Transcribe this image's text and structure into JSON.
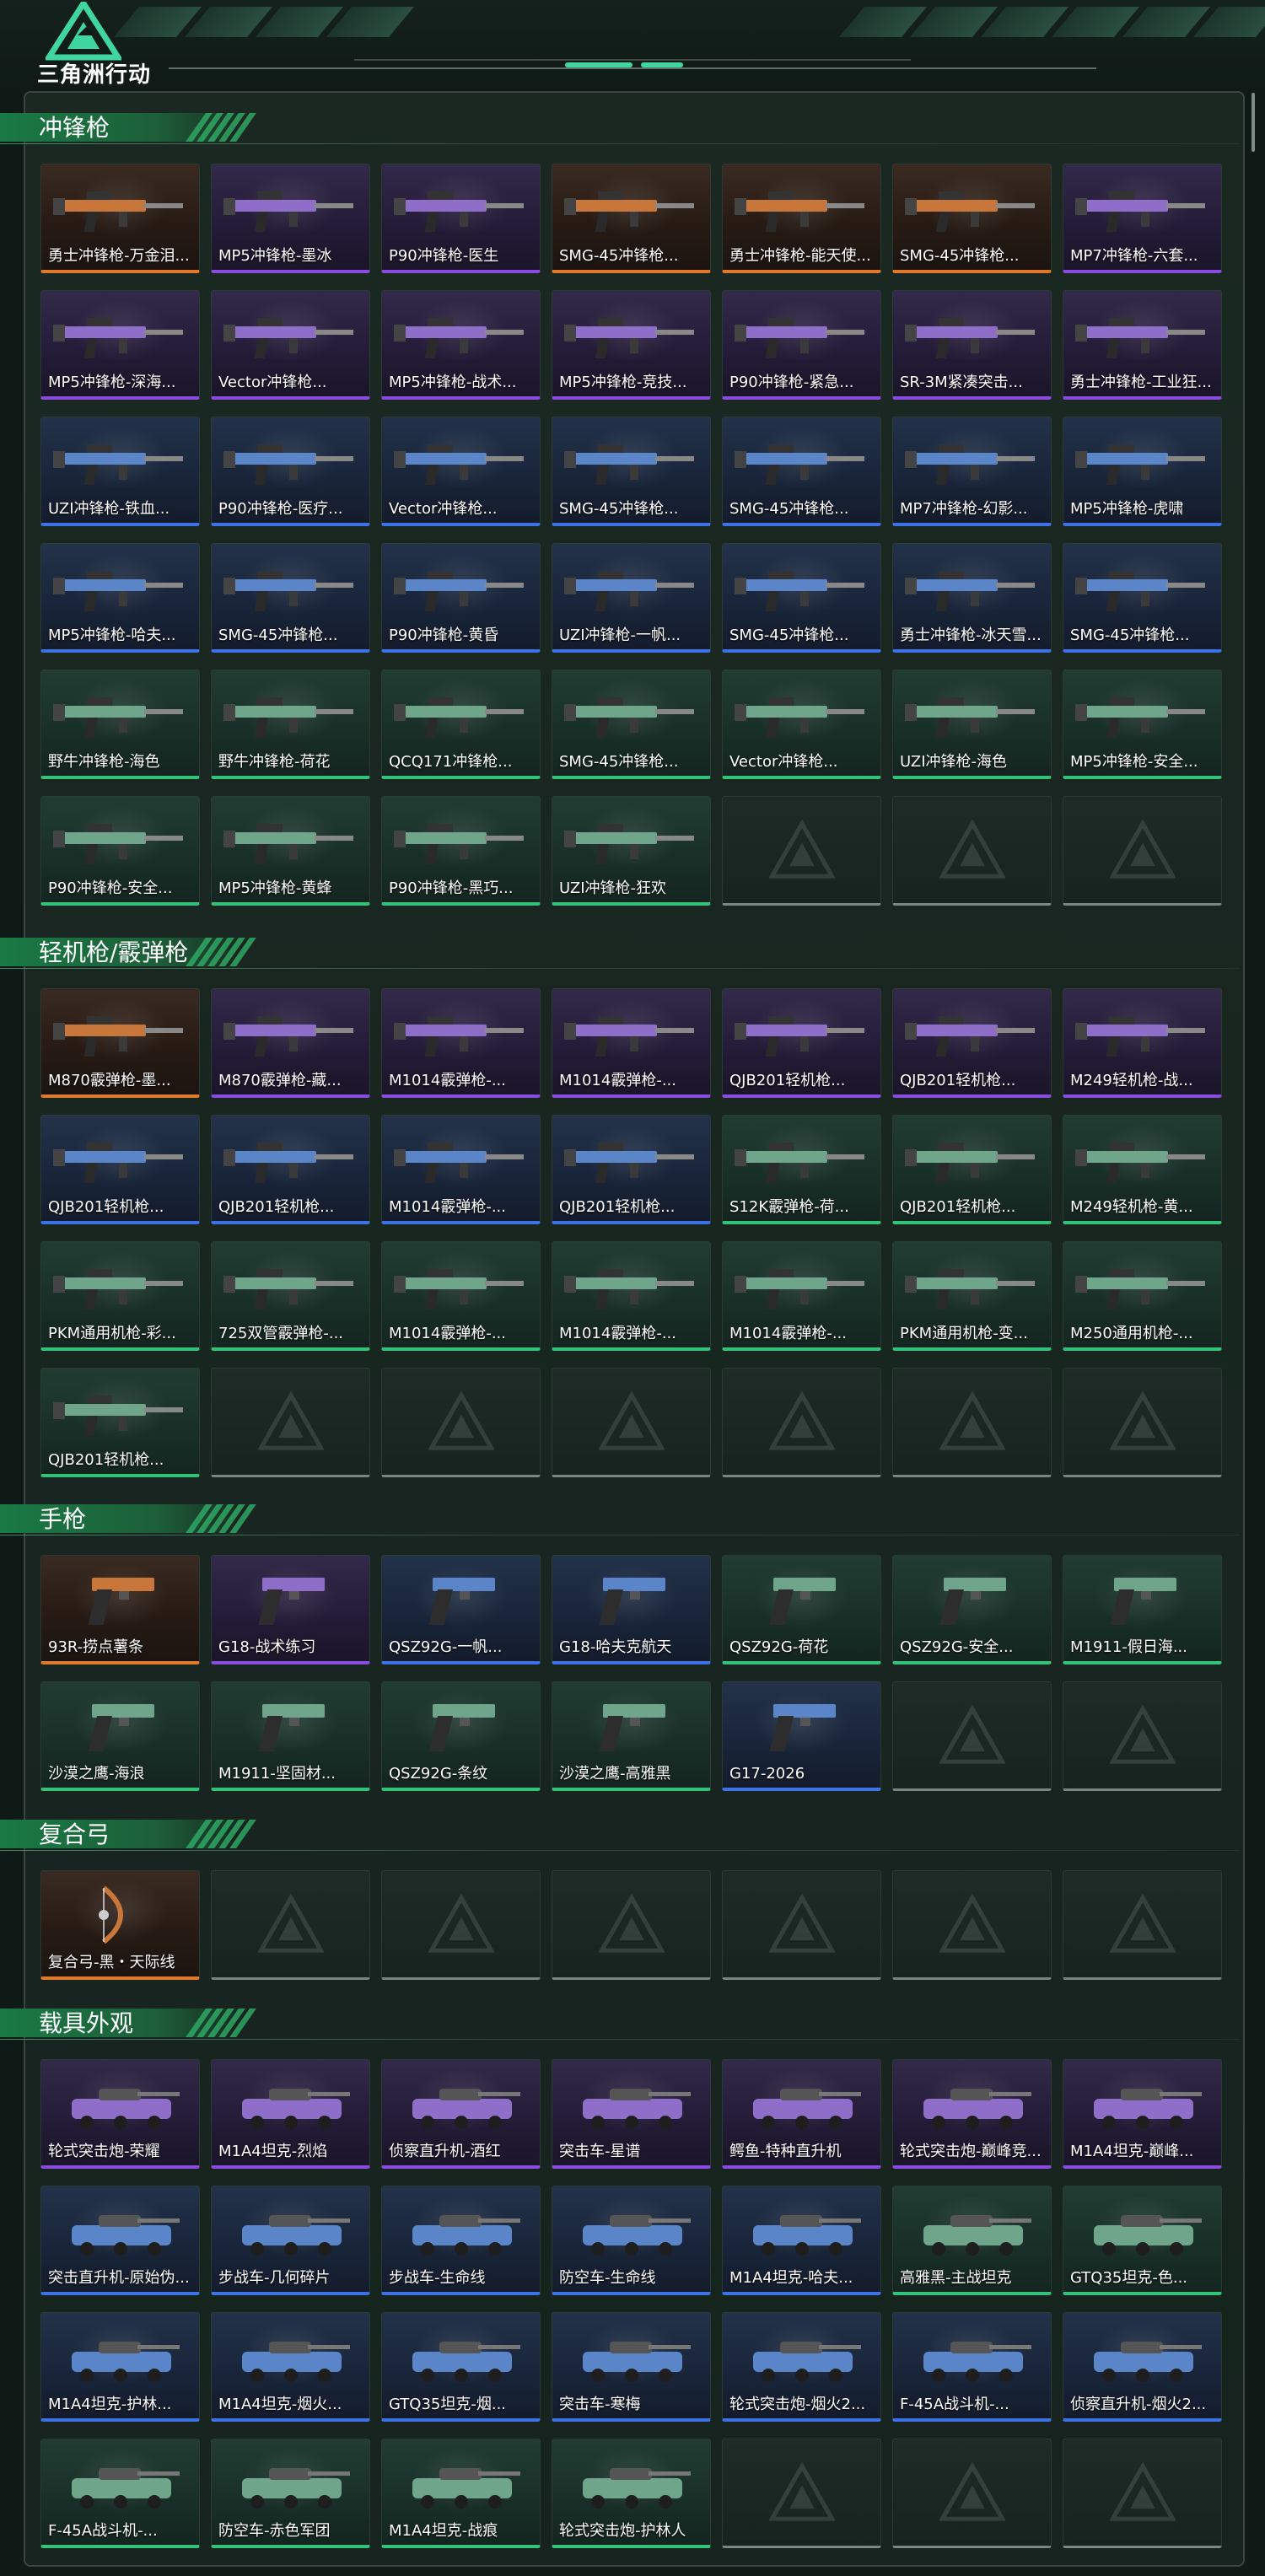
{
  "header": {
    "logo_text": "三角洲行动",
    "logo_icon": "delta-logo-icon"
  },
  "colors": {
    "orange": "#e07a2a",
    "purple": "#8a4ce0",
    "blue": "#3c72e6",
    "green": "#33c27a",
    "accent": "#3fd6a0"
  },
  "sections": [
    {
      "title": "冲锋枪",
      "kind": "gun",
      "items": [
        {
          "label": "勇士冲锋枪-万金泪...",
          "rarity": "orange"
        },
        {
          "label": "MP5冲锋枪-墨冰",
          "rarity": "purple"
        },
        {
          "label": "P90冲锋枪-医生",
          "rarity": "purple"
        },
        {
          "label": "SMG-45冲锋枪...",
          "rarity": "orange"
        },
        {
          "label": "勇士冲锋枪-能天使...",
          "rarity": "orange"
        },
        {
          "label": "SMG-45冲锋枪...",
          "rarity": "orange"
        },
        {
          "label": "MP7冲锋枪-六套...",
          "rarity": "purple"
        },
        {
          "label": "MP5冲锋枪-深海...",
          "rarity": "purple"
        },
        {
          "label": "Vector冲锋枪...",
          "rarity": "purple"
        },
        {
          "label": "MP5冲锋枪-战术...",
          "rarity": "purple"
        },
        {
          "label": "MP5冲锋枪-竞技...",
          "rarity": "purple"
        },
        {
          "label": "P90冲锋枪-紧急...",
          "rarity": "purple"
        },
        {
          "label": "SR-3M紧凑突击...",
          "rarity": "purple"
        },
        {
          "label": "勇士冲锋枪-工业狂...",
          "rarity": "purple"
        },
        {
          "label": "UZI冲锋枪-铁血...",
          "rarity": "blue"
        },
        {
          "label": "P90冲锋枪-医疗...",
          "rarity": "blue"
        },
        {
          "label": "Vector冲锋枪...",
          "rarity": "blue"
        },
        {
          "label": "SMG-45冲锋枪...",
          "rarity": "blue"
        },
        {
          "label": "SMG-45冲锋枪...",
          "rarity": "blue"
        },
        {
          "label": "MP7冲锋枪-幻影...",
          "rarity": "blue"
        },
        {
          "label": "MP5冲锋枪-虎啸",
          "rarity": "blue"
        },
        {
          "label": "MP5冲锋枪-哈夫...",
          "rarity": "blue"
        },
        {
          "label": "SMG-45冲锋枪...",
          "rarity": "blue"
        },
        {
          "label": "P90冲锋枪-黄昏",
          "rarity": "blue"
        },
        {
          "label": "UZI冲锋枪-一帆...",
          "rarity": "blue"
        },
        {
          "label": "SMG-45冲锋枪...",
          "rarity": "blue"
        },
        {
          "label": "勇士冲锋枪-冰天雪...",
          "rarity": "blue"
        },
        {
          "label": "SMG-45冲锋枪...",
          "rarity": "blue"
        },
        {
          "label": "野牛冲锋枪-海色",
          "rarity": "green"
        },
        {
          "label": "野牛冲锋枪-荷花",
          "rarity": "green"
        },
        {
          "label": "QCQ171冲锋枪...",
          "rarity": "green"
        },
        {
          "label": "SMG-45冲锋枪...",
          "rarity": "green"
        },
        {
          "label": "Vector冲锋枪...",
          "rarity": "green"
        },
        {
          "label": "UZI冲锋枪-海色",
          "rarity": "green"
        },
        {
          "label": "MP5冲锋枪-安全...",
          "rarity": "green"
        },
        {
          "label": "P90冲锋枪-安全...",
          "rarity": "green"
        },
        {
          "label": "MP5冲锋枪-黄蜂",
          "rarity": "green"
        },
        {
          "label": "P90冲锋枪-黑巧...",
          "rarity": "green"
        },
        {
          "label": "UZI冲锋枪-狂欢",
          "rarity": "green"
        }
      ],
      "empty": 3
    },
    {
      "title": "轻机枪/霰弹枪",
      "kind": "gun",
      "items": [
        {
          "label": "M870霰弹枪-墨...",
          "rarity": "orange"
        },
        {
          "label": "M870霰弹枪-藏...",
          "rarity": "purple"
        },
        {
          "label": "M1014霰弹枪-...",
          "rarity": "purple"
        },
        {
          "label": "M1014霰弹枪-...",
          "rarity": "purple"
        },
        {
          "label": "QJB201轻机枪...",
          "rarity": "purple"
        },
        {
          "label": "QJB201轻机枪...",
          "rarity": "purple"
        },
        {
          "label": "M249轻机枪-战...",
          "rarity": "purple"
        },
        {
          "label": "QJB201轻机枪...",
          "rarity": "blue"
        },
        {
          "label": "QJB201轻机枪...",
          "rarity": "blue"
        },
        {
          "label": "M1014霰弹枪-...",
          "rarity": "blue"
        },
        {
          "label": "QJB201轻机枪...",
          "rarity": "blue"
        },
        {
          "label": "S12K霰弹枪-荷...",
          "rarity": "green"
        },
        {
          "label": "QJB201轻机枪...",
          "rarity": "green"
        },
        {
          "label": "M249轻机枪-黄...",
          "rarity": "green"
        },
        {
          "label": "PKM通用机枪-彩...",
          "rarity": "green"
        },
        {
          "label": "725双管霰弹枪-...",
          "rarity": "green"
        },
        {
          "label": "M1014霰弹枪-...",
          "rarity": "green"
        },
        {
          "label": "M1014霰弹枪-...",
          "rarity": "green"
        },
        {
          "label": "M1014霰弹枪-...",
          "rarity": "green"
        },
        {
          "label": "PKM通用机枪-变...",
          "rarity": "green"
        },
        {
          "label": "M250通用机枪-...",
          "rarity": "green"
        },
        {
          "label": "QJB201轻机枪...",
          "rarity": "green"
        }
      ],
      "empty": 6
    },
    {
      "title": "手枪",
      "kind": "pistol",
      "items": [
        {
          "label": "93R-捞点薯条",
          "rarity": "orange"
        },
        {
          "label": "G18-战术练习",
          "rarity": "purple"
        },
        {
          "label": "QSZ92G-一帆...",
          "rarity": "blue"
        },
        {
          "label": "G18-哈夫克航天",
          "rarity": "blue"
        },
        {
          "label": "QSZ92G-荷花",
          "rarity": "green"
        },
        {
          "label": "QSZ92G-安全...",
          "rarity": "green"
        },
        {
          "label": "M1911-假日海...",
          "rarity": "green"
        },
        {
          "label": "沙漠之鹰-海浪",
          "rarity": "green"
        },
        {
          "label": "M1911-坚固材...",
          "rarity": "green"
        },
        {
          "label": "QSZ92G-条纹",
          "rarity": "green"
        },
        {
          "label": "沙漠之鹰-高雅黑",
          "rarity": "green"
        },
        {
          "label": "G17-2026",
          "rarity": "blue"
        }
      ],
      "empty": 2
    },
    {
      "title": "复合弓",
      "kind": "bow",
      "items": [
        {
          "label": "复合弓-黑・天际线",
          "rarity": "orange"
        }
      ],
      "empty": 6
    },
    {
      "title": "载具外观",
      "kind": "vehicle",
      "items": [
        {
          "label": "轮式突击炮-荣耀",
          "rarity": "purple"
        },
        {
          "label": "M1A4坦克-烈焰",
          "rarity": "purple"
        },
        {
          "label": "侦察直升机-酒红",
          "rarity": "purple"
        },
        {
          "label": "突击车-星谱",
          "rarity": "purple"
        },
        {
          "label": "鳄鱼-特种直升机",
          "rarity": "purple"
        },
        {
          "label": "轮式突击炮-巅峰竞...",
          "rarity": "purple"
        },
        {
          "label": "M1A4坦克-巅峰...",
          "rarity": "purple"
        },
        {
          "label": "突击直升机-原始伪...",
          "rarity": "blue"
        },
        {
          "label": "步战车-几何碎片",
          "rarity": "blue"
        },
        {
          "label": "步战车-生命线",
          "rarity": "blue"
        },
        {
          "label": "防空车-生命线",
          "rarity": "blue"
        },
        {
          "label": "M1A4坦克-哈夫...",
          "rarity": "blue"
        },
        {
          "label": "高雅黑-主战坦克",
          "rarity": "green"
        },
        {
          "label": "GTQ35坦克-色...",
          "rarity": "green"
        },
        {
          "label": "M1A4坦克-护林...",
          "rarity": "blue"
        },
        {
          "label": "M1A4坦克-烟火...",
          "rarity": "blue"
        },
        {
          "label": "GTQ35坦克-烟...",
          "rarity": "blue"
        },
        {
          "label": "突击车-寒梅",
          "rarity": "blue"
        },
        {
          "label": "轮式突击炮-烟火2...",
          "rarity": "blue"
        },
        {
          "label": "F-45A战斗机-...",
          "rarity": "blue"
        },
        {
          "label": "侦察直升机-烟火2...",
          "rarity": "blue"
        },
        {
          "label": "F-45A战斗机-...",
          "rarity": "green"
        },
        {
          "label": "防空车-赤色军团",
          "rarity": "green"
        },
        {
          "label": "M1A4坦克-战痕",
          "rarity": "green"
        },
        {
          "label": "轮式突击炮-护林人",
          "rarity": "green"
        }
      ],
      "empty": 3
    }
  ]
}
